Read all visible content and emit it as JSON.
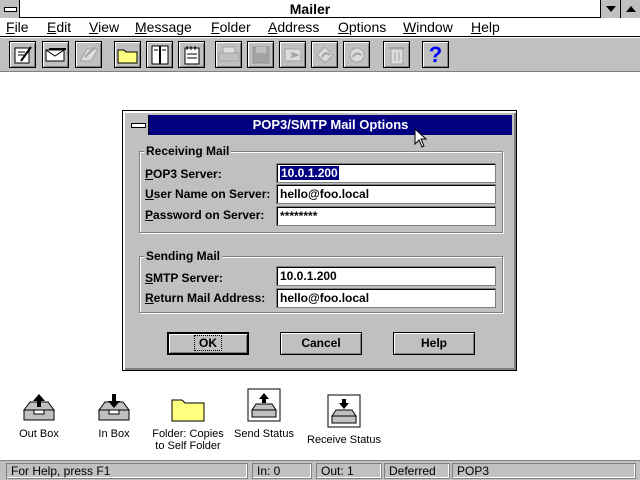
{
  "window": {
    "title": "Mailer"
  },
  "menu": [
    "File",
    "Edit",
    "View",
    "Message",
    "Folder",
    "Address",
    "Options",
    "Window",
    "Help"
  ],
  "toolbar": {
    "help_glyph": "?"
  },
  "dialog": {
    "title": "POP3/SMTP Mail Options",
    "receiving": {
      "label": "Receiving Mail",
      "pop3_label": "POP3 Server:",
      "pop3_value": "10.0.1.200",
      "user_label": "User Name on Server:",
      "user_value": "hello@foo.local",
      "password_label": "Password on Server:",
      "password_value": "********"
    },
    "sending": {
      "label": "Sending Mail",
      "smtp_label": "SMTP Server:",
      "smtp_value": "10.0.1.200",
      "return_label": "Return Mail Address:",
      "return_value": "hello@foo.local"
    },
    "buttons": {
      "ok": "OK",
      "cancel": "Cancel",
      "help": "Help"
    }
  },
  "desktop_icons": [
    {
      "label": "Out Box",
      "icon": "outbox-tray-icon"
    },
    {
      "label": "In Box",
      "icon": "inbox-tray-icon"
    },
    {
      "label": "Folder: Copies to Self Folder",
      "icon": "folder-icon"
    },
    {
      "label": "Send Status",
      "icon": "send-status-icon"
    },
    {
      "label": "Receive Status",
      "icon": "receive-status-icon"
    }
  ],
  "status": {
    "help_text": "For Help, press F1",
    "in": "In: 0",
    "out": "Out: 1",
    "mode": "Deferred",
    "protocol": "POP3"
  },
  "colors": {
    "dialog_title_bg": "#000080",
    "face": "#c0c0c0",
    "selection": "#000080"
  }
}
